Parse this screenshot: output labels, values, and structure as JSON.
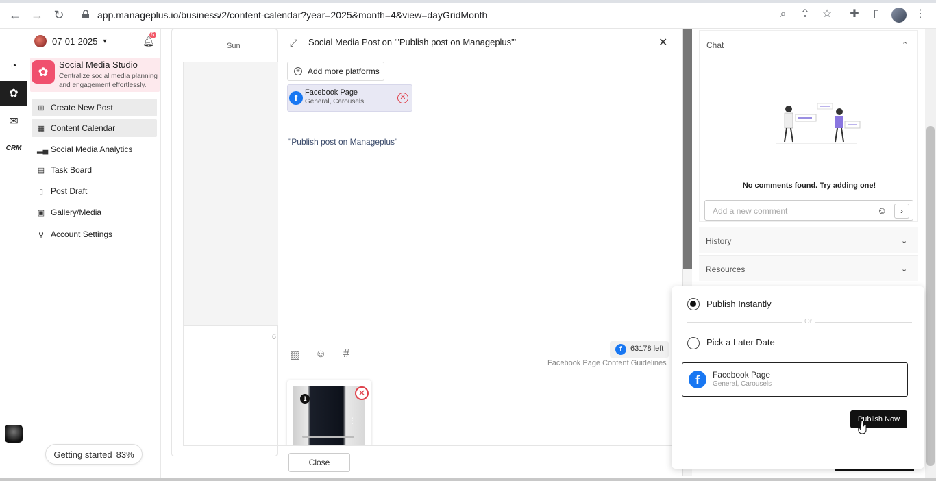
{
  "browser": {
    "url": "app.manageplus.io/business/2/content-calendar?year=2025&month=4&view=dayGridMonth"
  },
  "sidebar": {
    "date": "07-01-2025",
    "notification_count": "5",
    "studio_title": "Social Media Studio",
    "studio_subtitle": "Centralize social media planning and engagement effortlessly.",
    "items": [
      {
        "label": "Create New Post",
        "icon": "create-post-icon"
      },
      {
        "label": "Content Calendar",
        "icon": "calendar-icon"
      },
      {
        "label": "Social Media Analytics",
        "icon": "analytics-icon"
      },
      {
        "label": "Task Board",
        "icon": "task-board-icon"
      },
      {
        "label": "Post Draft",
        "icon": "draft-icon"
      },
      {
        "label": "Gallery/Media",
        "icon": "gallery-icon"
      },
      {
        "label": "Account Settings",
        "icon": "user-icon"
      }
    ],
    "getting_started": "Getting started",
    "getting_started_pct": "83%"
  },
  "rail": {
    "items": [
      "dashboard-icon",
      "social-studio-icon",
      "email-icon",
      "crm-icon"
    ],
    "crm_label": "CRM"
  },
  "calendar": {
    "day_header": "Sun",
    "day_number": "6"
  },
  "modal": {
    "title": "Social Media Post on '\"Publish post on Manageplus\"'",
    "add_platforms": "Add more platforms",
    "platform_name": "Facebook Page",
    "platform_types": "General, Carousels",
    "post_text": "\"Publish post on Manageplus\"",
    "chars_left": "63178 left",
    "guidelines": "Facebook Page Content Guidelines",
    "media_index": "1",
    "close_label": "Close"
  },
  "right_panel": {
    "chat_label": "Chat",
    "empty_text": "No comments found. Try adding one!",
    "comment_placeholder": "Add a new comment",
    "history_label": "History",
    "resources_label": "Resources"
  },
  "publish": {
    "instant_label": "Publish Instantly",
    "or_label": "Or",
    "later_label": "Pick a Later Date",
    "platform_name": "Facebook Page",
    "platform_types": "General, Carousels",
    "button_label": "Publish Now",
    "selected": "instant"
  },
  "colors": {
    "accent": "#f0506e",
    "facebook": "#1877f2",
    "danger": "#e0404a"
  }
}
